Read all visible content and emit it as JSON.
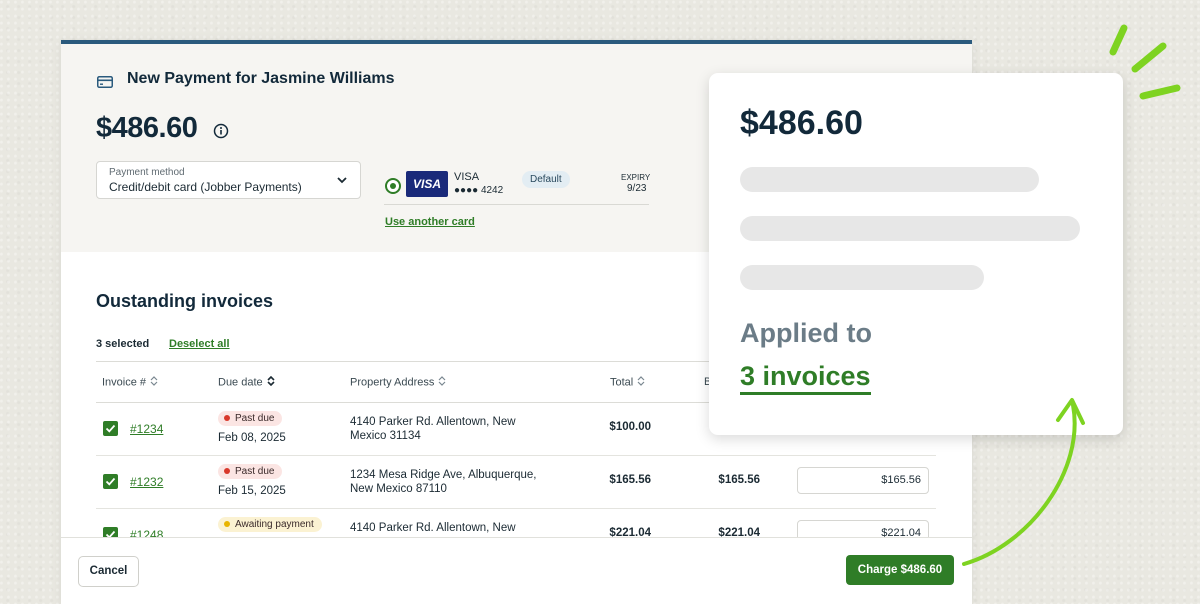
{
  "modal": {
    "title": "New Payment for Jasmine Williams",
    "amount": "$486.60",
    "payment_method": {
      "label": "Payment method",
      "value": "Credit/debit card (Jobber Payments)"
    },
    "card": {
      "brand_logo": "VISA",
      "brand": "VISA",
      "masked_number": "●●●● 4242",
      "badge": "Default",
      "expiry_label": "EXPIRY",
      "expiry_value": "9/23",
      "use_another_label": "Use another card"
    },
    "invoices": {
      "title": "Oustanding invoices",
      "selected_count": "3 selected",
      "deselect_label": "Deselect all",
      "columns": [
        "Invoice #",
        "Due date",
        "Property Address",
        "Total",
        "B"
      ],
      "rows": [
        {
          "number": "#1234",
          "status": "Past due",
          "status_type": "past",
          "due": "Feb 08, 2025",
          "address": "4140 Parker Rd. Allentown, New Mexico 31134",
          "total": "$100.00",
          "balance": "",
          "payment": ""
        },
        {
          "number": "#1232",
          "status": "Past due",
          "status_type": "past",
          "due": "Feb 15, 2025",
          "address": "1234 Mesa Ridge Ave, Albuquerque, New Mexico 87110",
          "total": "$165.56",
          "balance": "$165.56",
          "payment": "$165.56"
        },
        {
          "number": "#1248",
          "status": "Awaiting payment",
          "status_type": "await",
          "due": "",
          "address": "4140 Parker Rd. Allentown, New",
          "total": "$221.04",
          "balance": "$221.04",
          "payment": "$221.04"
        }
      ]
    },
    "footer": {
      "cancel_label": "Cancel",
      "charge_label": "Charge $486.60"
    }
  },
  "popup": {
    "amount": "$486.60",
    "applied_label": "Applied to",
    "applied_count": "3 invoices"
  },
  "colors": {
    "accent_green": "#2f7d27",
    "header_blue": "#2a5a7d",
    "highlight_lime": "#7ed321"
  }
}
